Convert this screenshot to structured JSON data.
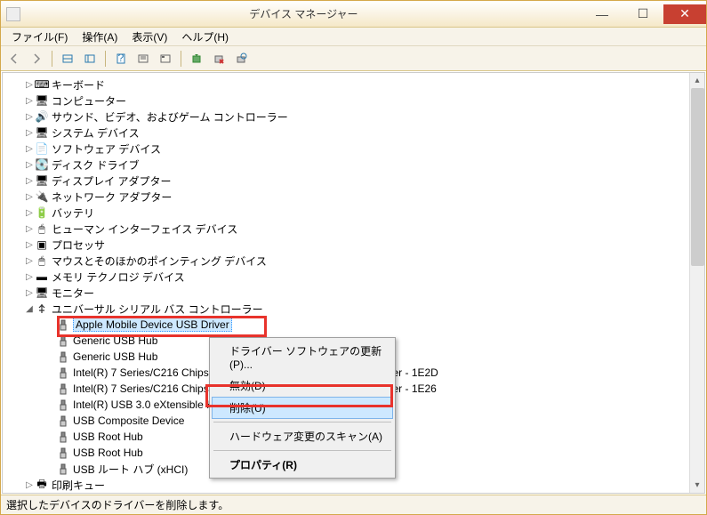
{
  "window": {
    "title": "デバイス マネージャー"
  },
  "menubar": {
    "file": "ファイル(F)",
    "action": "操作(A)",
    "view": "表示(V)",
    "help": "ヘルプ(H)"
  },
  "tree": {
    "items": [
      {
        "label": "キーボード",
        "icon": "keyboard"
      },
      {
        "label": "コンピューター",
        "icon": "computer"
      },
      {
        "label": "サウンド、ビデオ、およびゲーム コントローラー",
        "icon": "sound"
      },
      {
        "label": "システム デバイス",
        "icon": "system"
      },
      {
        "label": "ソフトウェア デバイス",
        "icon": "software"
      },
      {
        "label": "ディスク ドライブ",
        "icon": "disk"
      },
      {
        "label": "ディスプレイ アダプター",
        "icon": "display"
      },
      {
        "label": "ネットワーク アダプター",
        "icon": "network"
      },
      {
        "label": "バッテリ",
        "icon": "battery"
      },
      {
        "label": "ヒューマン インターフェイス デバイス",
        "icon": "hid"
      },
      {
        "label": "プロセッサ",
        "icon": "cpu"
      },
      {
        "label": "マウスとそのほかのポインティング デバイス",
        "icon": "mouse"
      },
      {
        "label": "メモリ テクノロジ デバイス",
        "icon": "memory"
      },
      {
        "label": "モニター",
        "icon": "monitor"
      }
    ],
    "usb_category": "ユニバーサル シリアル バス コントローラー",
    "usb_items": [
      "Apple Mobile Device USB Driver",
      "Generic USB Hub",
      "Generic USB Hub",
      "Intel(R) 7 Series/C216 Chipset Family USB Enhanced Host Controller - 1E2D",
      "Intel(R) 7 Series/C216 Chipset Family USB Enhanced Host Controller - 1E26",
      "Intel(R) USB 3.0 eXtensible Host Controller",
      "USB Composite Device",
      "USB Root Hub",
      "USB Root Hub",
      "USB ルート ハブ (xHCI)"
    ],
    "last_cut": "印刷キュー"
  },
  "context_menu": {
    "update": "ドライバー ソフトウェアの更新(P)...",
    "disable": "無効(D)",
    "uninstall": "削除(U)",
    "scan": "ハードウェア変更のスキャン(A)",
    "properties": "プロパティ(R)"
  },
  "statusbar": {
    "text": "選択したデバイスのドライバーを削除します。"
  }
}
